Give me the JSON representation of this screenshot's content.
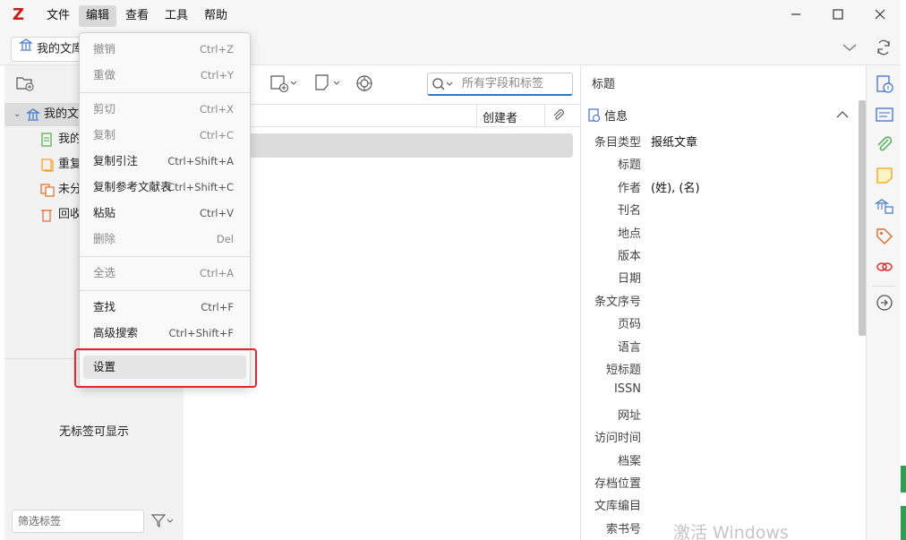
{
  "menubar": {
    "logo": "Z",
    "items": [
      "文件",
      "编辑",
      "查看",
      "工具",
      "帮助"
    ],
    "active_index": 1
  },
  "tab": {
    "library_label": "我的文库"
  },
  "edit_menu": {
    "undo": {
      "label": "撤销",
      "shortcut": "Ctrl+Z"
    },
    "redo": {
      "label": "重做",
      "shortcut": "Ctrl+Y"
    },
    "cut": {
      "label": "剪切",
      "shortcut": "Ctrl+X"
    },
    "copy": {
      "label": "复制",
      "shortcut": "Ctrl+C"
    },
    "copy_citation": {
      "label": "复制引注",
      "shortcut": "Ctrl+Shift+A"
    },
    "copy_bibliography": {
      "label": "复制参考文献表",
      "shortcut": "Ctrl+Shift+C"
    },
    "paste": {
      "label": "粘贴",
      "shortcut": "Ctrl+V"
    },
    "delete": {
      "label": "删除",
      "shortcut": "Del"
    },
    "select_all": {
      "label": "全选",
      "shortcut": "Ctrl+A"
    },
    "find": {
      "label": "查找",
      "shortcut": "Ctrl+F"
    },
    "advanced_search": {
      "label": "高级搜索",
      "shortcut": "Ctrl+Shift+F"
    },
    "settings": {
      "label": "设置"
    }
  },
  "collections": {
    "library": "我的文",
    "my_pubs": "我的",
    "duplicates": "重复",
    "unfiled": "未分",
    "trash": "回收"
  },
  "tags": {
    "empty_message": "无标签可显示",
    "filter_placeholder": "筛选标签"
  },
  "search": {
    "placeholder": "所有字段和标签"
  },
  "columns": {
    "creator": "创建者"
  },
  "item_pane": {
    "title": "标题",
    "section": "信息",
    "fields": [
      {
        "label": "条目类型",
        "value": "报纸文章"
      },
      {
        "label": "标题",
        "value": ""
      },
      {
        "label": "作者",
        "value": "(姓), (名)"
      },
      {
        "label": "刊名",
        "value": ""
      },
      {
        "label": "地点",
        "value": ""
      },
      {
        "label": "版本",
        "value": ""
      },
      {
        "label": "日期",
        "value": ""
      },
      {
        "label": "条文序号",
        "value": ""
      },
      {
        "label": "页码",
        "value": ""
      },
      {
        "label": "语言",
        "value": ""
      },
      {
        "label": "短标题",
        "value": ""
      },
      {
        "label": "ISSN",
        "value": ""
      },
      {
        "label": "网址",
        "value": ""
      },
      {
        "label": "访问时间",
        "value": ""
      },
      {
        "label": "档案",
        "value": ""
      },
      {
        "label": "存档位置",
        "value": ""
      },
      {
        "label": "文库编目",
        "value": ""
      },
      {
        "label": "索书号",
        "value": ""
      }
    ]
  },
  "watermark": "激活 Windows",
  "colors": {
    "accent_red": "#e5262b",
    "logo_red": "#d11a1a",
    "side_blue": "#3b73c7",
    "side_green": "#4caf50",
    "side_orange": "#f0a020"
  }
}
